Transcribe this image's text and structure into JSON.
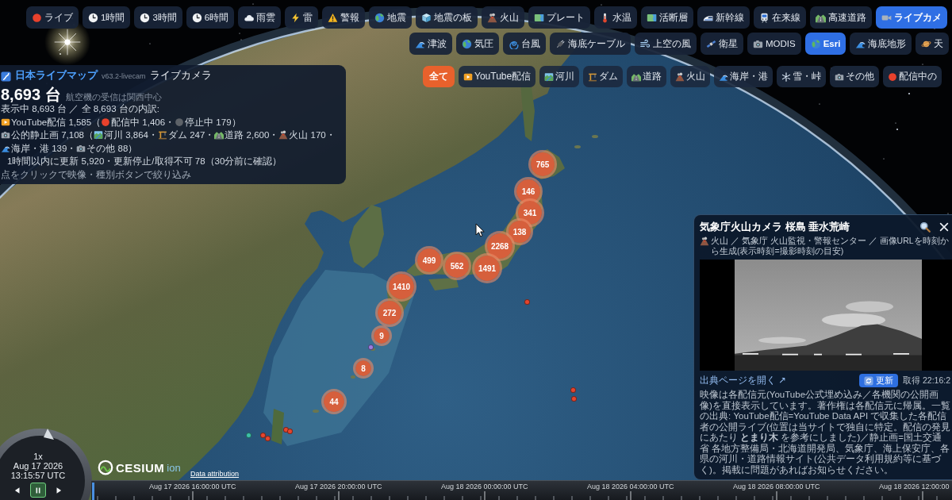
{
  "toolbar_row_1": [
    {
      "label": "ライブ",
      "kind": "live",
      "selected": false
    },
    {
      "label": "1時間",
      "kind": "clock",
      "selected": false
    },
    {
      "label": "3時間",
      "kind": "clock",
      "selected": false
    },
    {
      "label": "6時間",
      "kind": "clock",
      "selected": false
    },
    {
      "label": "雨雲",
      "kind": "cloud",
      "selected": false
    },
    {
      "label": "雷",
      "kind": "bolt",
      "selected": false
    },
    {
      "label": "警報",
      "kind": "warning",
      "selected": false
    },
    {
      "label": "地震",
      "kind": "globe",
      "selected": false
    },
    {
      "label": "地震の板",
      "kind": "cube",
      "selected": false
    },
    {
      "label": "火山",
      "kind": "volcano",
      "selected": false
    },
    {
      "label": "プレート",
      "kind": "map",
      "selected": false
    },
    {
      "label": "水温",
      "kind": "thermometer",
      "selected": false
    },
    {
      "label": "活断層",
      "kind": "map",
      "selected": false
    },
    {
      "label": "新幹線",
      "kind": "bullettrain",
      "selected": false
    },
    {
      "label": "在来線",
      "kind": "train",
      "selected": false
    },
    {
      "label": "高速道路",
      "kind": "highway",
      "selected": false
    },
    {
      "label": "ライブカメ",
      "kind": "videocamera",
      "selected": true
    }
  ],
  "toolbar_row_2": [
    {
      "label": "津波",
      "kind": "wave",
      "selected": false
    },
    {
      "label": "気圧",
      "kind": "globe",
      "selected": false
    },
    {
      "label": "台風",
      "kind": "cyclone",
      "selected": false
    },
    {
      "label": "海底ケーブル",
      "kind": "plug",
      "selected": false
    },
    {
      "label": "上空の風",
      "kind": "wind",
      "selected": false
    },
    {
      "label": "衛星",
      "kind": "satellite",
      "selected": false
    },
    {
      "label": "MODIS",
      "kind": "camera",
      "selected": false
    },
    {
      "label": "Esri",
      "kind": "globe",
      "selected": true
    },
    {
      "label": "海底地形",
      "kind": "wave",
      "selected": false
    },
    {
      "label": "天",
      "kind": "planet",
      "selected": false
    }
  ],
  "info_panel": {
    "app_name": "日本ライブマップ",
    "version": "v63.2-livecam",
    "mode": "ライブカメラ",
    "total": "8,693 台",
    "note": "航空機の受信は関西中心",
    "summary": "表示中 8,693 台 ／ 全 8,693 台の内訳:",
    "breakdown": [
      [
        {
          "kind": "youtube",
          "text": "YouTube配信 1,585（"
        },
        {
          "kind": "live",
          "text": "配信中 1,406・"
        },
        {
          "kind": "stopped",
          "text": "停止中 179）"
        }
      ],
      [
        {
          "kind": "camera",
          "text": "公的静止画 7,108（"
        },
        {
          "kind": "river",
          "text": "河川 3,864・"
        },
        {
          "kind": "dam",
          "text": "ダム 247・"
        },
        {
          "kind": "road",
          "text": "道路 2,600・"
        },
        {
          "kind": "volcano",
          "text": "火山 170・"
        },
        {
          "kind": "wave",
          "text": "海岸・港 139・"
        },
        {
          "kind": "camera",
          "text": "その他 88）"
        }
      ]
    ],
    "freshness": "1時間以内に更新 5,920・更新停止/取得不可 78（30分前に確認）",
    "hint": "点をクリックで映像・種別ボタンで絞り込み"
  },
  "filters": [
    {
      "label": "全て",
      "kind": "all",
      "selected": true
    },
    {
      "label": "YouTube配信",
      "kind": "youtube",
      "selected": false
    },
    {
      "label": "河川",
      "kind": "river",
      "selected": false
    },
    {
      "label": "ダム",
      "kind": "dam",
      "selected": false
    },
    {
      "label": "道路",
      "kind": "road",
      "selected": false
    },
    {
      "label": "火山",
      "kind": "volcano",
      "selected": false
    },
    {
      "label": "海岸・港",
      "kind": "wave",
      "selected": false
    },
    {
      "label": "雪・峠",
      "kind": "snow",
      "selected": false
    },
    {
      "label": "その他",
      "kind": "camera",
      "selected": false
    },
    {
      "label": "配信中の",
      "kind": "live",
      "selected": false
    }
  ],
  "clusters": [
    {
      "count": "765"
    },
    {
      "count": "146"
    },
    {
      "count": "341"
    },
    {
      "count": "138"
    },
    {
      "count": "2268"
    },
    {
      "count": "499"
    },
    {
      "count": "1491"
    },
    {
      "count": "562"
    },
    {
      "count": "1410"
    },
    {
      "count": "272"
    },
    {
      "count": "9"
    },
    {
      "count": "8"
    },
    {
      "count": "44"
    }
  ],
  "points": [
    {
      "color": "#e5452e"
    },
    {
      "color": "#9b7be0"
    },
    {
      "color": "#e5452e"
    },
    {
      "color": "#e5452e"
    },
    {
      "color": "#3cc0a8"
    },
    {
      "color": "#e5452e"
    },
    {
      "color": "#e5452e"
    },
    {
      "color": "#e5452e"
    },
    {
      "color": "#e5452e"
    }
  ],
  "camera_panel": {
    "title": "気象庁火山カメラ 桜島 垂水荒崎",
    "source": "火山 ／ 気象庁 火山監視・警報センター ／ 画像URLを時刻から生成(表示時刻=撮影時刻の目安)",
    "source_link": "出典ページを開く ↗",
    "refresh_button": "更新",
    "fetched": "取得 22:16:2",
    "notice": "映像は各配信元(YouTube公式埋め込み／各機関の公開画像)を直接表示しています。著作権は各配信元に帰属。一覧の出典: YouTube配信=YouTube Data API で収集した各配信者の公開ライブ(位置は当サイトで独自に特定。配信の発見にあたり **とまり木** を参考にしました)／静止画=国土交通省 各地方整備局・北海道開発局、気象庁、海上保安庁、各県の河川・道路情報サイト(公共データ利用規約等に基づく)。掲載に問題があればお知らせください。"
  },
  "clock": {
    "speed": "1x",
    "date": "Aug 17 2026",
    "time": "13:15:57 UTC",
    "controls": [
      {
        "kind": "back",
        "selected": false
      },
      {
        "kind": "pause",
        "selected": true
      },
      {
        "kind": "forward",
        "selected": false
      }
    ]
  },
  "logo": {
    "name": "CESIUM",
    "suffix": "ion"
  },
  "attribution_link": "Data attribution",
  "timeline": {
    "labels": [
      "Aug 17 2026 16:00:00 UTC",
      "Aug 17 2026 20:00:00 UTC",
      "Aug 18 2026 00:00:00 UTC",
      "Aug 18 2026 04:00:00 UTC",
      "Aug 18 2026 08:00:00 UTC",
      "Aug 18 2026 12:00:00"
    ]
  }
}
